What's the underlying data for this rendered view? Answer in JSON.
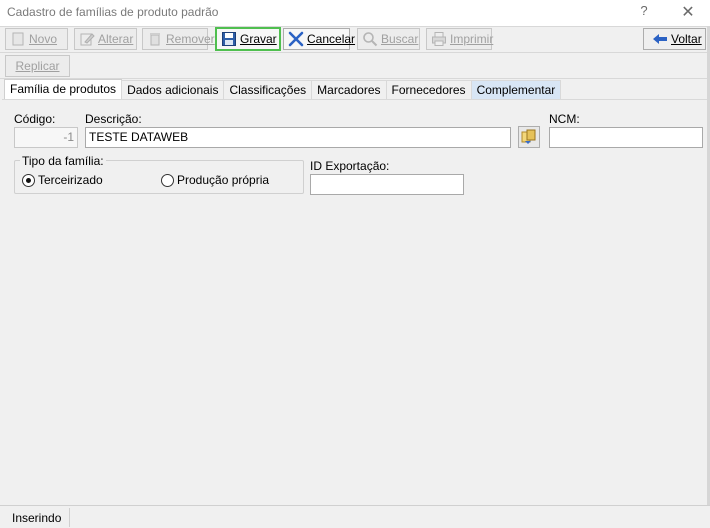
{
  "window": {
    "title": "Cadastro de famílias de produto padrão",
    "help_label": "?",
    "close_label": "✕"
  },
  "toolbar": {
    "novo_label": "Novo",
    "alterar_label": "Alterar",
    "remover_label": "Remover",
    "gravar_label": "Gravar",
    "cancelar_label": "Cancelar",
    "buscar_label": "Buscar",
    "imprimir_label": "Imprimir",
    "voltar_label": "Voltar",
    "replicar_label": "Replicar"
  },
  "tabs": [
    {
      "label": "Família de produtos"
    },
    {
      "label": "Dados adicionais"
    },
    {
      "label": "Classificações"
    },
    {
      "label": "Marcadores"
    },
    {
      "label": "Fornecedores"
    },
    {
      "label": "Complementar"
    }
  ],
  "form": {
    "codigo_label": "Código:",
    "codigo_value": "-1",
    "descricao_label": "Descrição:",
    "descricao_value": "TESTE DATAWEB",
    "ncm_label": "NCM:",
    "ncm_value": "",
    "tipo_familia_label": "Tipo da família:",
    "terceirizado_label": "Terceirizado",
    "producao_propria_label": "Produção própria",
    "tipo_familia_selected": "Terceirizado",
    "id_exportacao_label": "ID Exportação:",
    "id_exportacao_value": ""
  },
  "status": {
    "mode": "Inserindo"
  }
}
